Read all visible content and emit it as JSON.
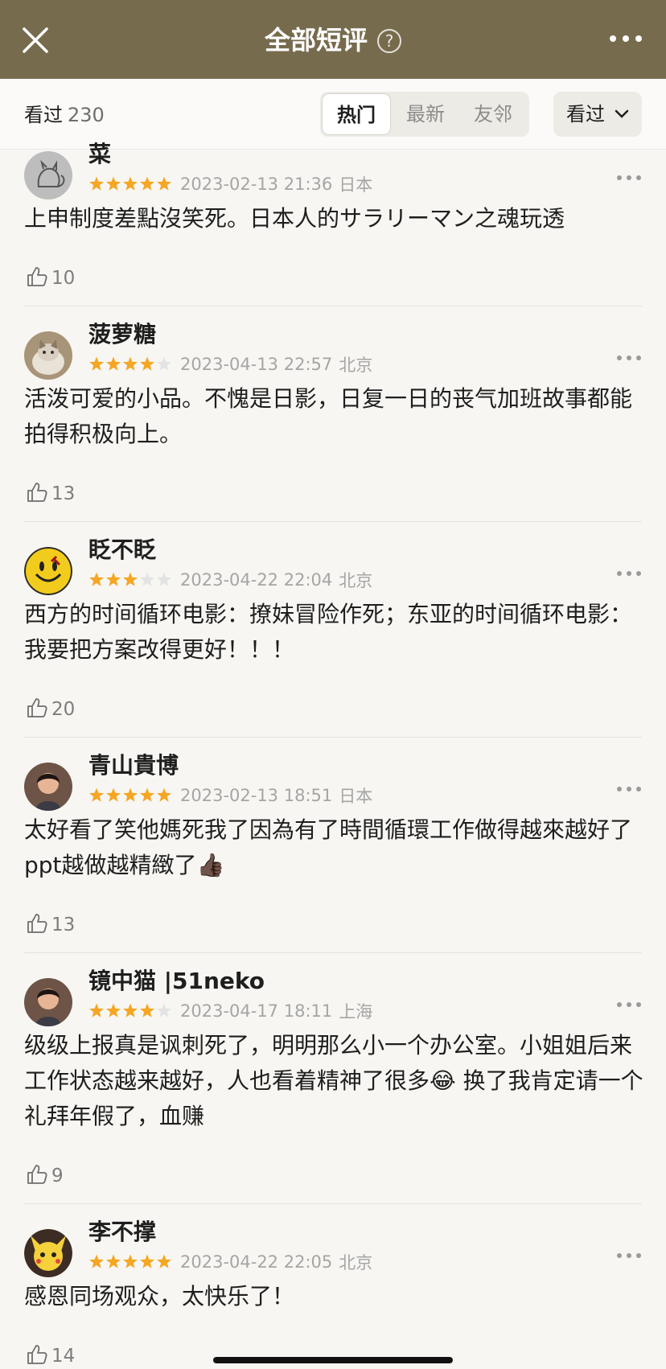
{
  "header": {
    "title": "全部短评",
    "help_glyph": "?",
    "close_icon": "close-icon",
    "more_icon": "more-horizontal-icon",
    "background_color": "#776b4e"
  },
  "filter": {
    "seen_label": "看过",
    "seen_count": "230",
    "tabs": [
      {
        "label": "热门",
        "active": true
      },
      {
        "label": "最新",
        "active": false
      },
      {
        "label": "友邻",
        "active": false
      }
    ],
    "dropdown_label": "看过"
  },
  "reviews": [
    {
      "user": "菜",
      "rating": 5,
      "time": "2023-02-13 21:36",
      "location": "日本",
      "content": "上申制度差點沒笑死。日本人的サラリーマン之魂玩透",
      "likes": "10",
      "avatar_icon": "cat-sketch-avatar"
    },
    {
      "user": "菠萝糖",
      "rating": 4,
      "time": "2023-04-13 22:57",
      "location": "北京",
      "content": "活泼可爱的小品。不愧是日影，日复一日的丧气加班故事都能拍得积极向上。",
      "likes": "13",
      "avatar_icon": "cat-photo-avatar"
    },
    {
      "user": "眨不眨",
      "rating": 3,
      "time": "2023-04-22 22:04",
      "location": "北京",
      "content": "西方的时间循环电影：撩妹冒险作死；东亚的时间循环电影：我要把方案改得更好！！！",
      "likes": "20",
      "avatar_icon": "smiley-face-avatar"
    },
    {
      "user": "青山貴博",
      "rating": 5,
      "time": "2023-02-13 18:51",
      "location": "日本",
      "content": "太好看了笑他媽死我了因為有了時間循環工作做得越來越好了ppt越做越精緻了👍🏿",
      "likes": "13",
      "avatar_icon": "portrait-avatar"
    },
    {
      "user": "镜中猫 |51neko",
      "rating": 4,
      "time": "2023-04-17 18:11",
      "location": "上海",
      "content": "级级上报真是讽刺死了，明明那么小一个办公室。小姐姐后来工作状态越来越好，人也看着精神了很多😂 换了我肯定请一个礼拜年假了，血赚",
      "likes": "9",
      "avatar_icon": "portrait-avatar"
    },
    {
      "user": "李不撑",
      "rating": 5,
      "time": "2023-04-22 22:05",
      "location": "北京",
      "content": "感恩同场观众，太快乐了！",
      "likes": "14",
      "avatar_icon": "pikachu-avatar"
    }
  ],
  "colors": {
    "star_filled": "#f5a623",
    "star_empty": "#e3e3e3",
    "secondary_text": "#a5a5a5"
  }
}
